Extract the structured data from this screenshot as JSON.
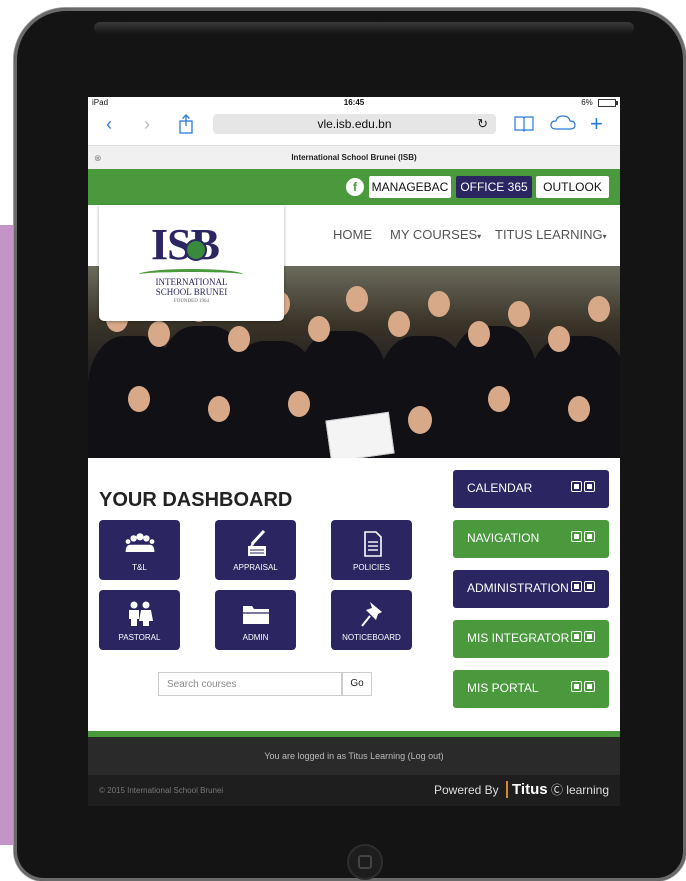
{
  "status_bar": {
    "device": "iPad",
    "time": "16:45",
    "battery": "6%"
  },
  "browser": {
    "url": "vle.isb.edu.bn",
    "tab_title": "International School Brunei (ISB)"
  },
  "top_links": {
    "facebook": "f",
    "managebac": "MANAGEBAC",
    "office365": "OFFICE 365",
    "outlook": "OUTLOOK"
  },
  "nav": {
    "home": "HOME",
    "my_courses": "MY COURSES",
    "titus_learning": "TITUS LEARNING"
  },
  "logo": {
    "mark": "ISB",
    "line1": "INTERNATIONAL",
    "line2": "SCHOOL BRUNEI",
    "line3": "FOUNDED 1964"
  },
  "dashboard": {
    "title": "YOUR DASHBOARD",
    "tiles": [
      {
        "label": "T&L",
        "icon": "group-icon"
      },
      {
        "label": "APPRAISAL",
        "icon": "pen-paper-icon"
      },
      {
        "label": "POLICIES",
        "icon": "document-icon"
      },
      {
        "label": "PASTORAL",
        "icon": "children-icon"
      },
      {
        "label": "ADMIN",
        "icon": "folder-icon"
      },
      {
        "label": "NOTICEBOARD",
        "icon": "pin-icon"
      }
    ]
  },
  "search": {
    "placeholder": "Search courses",
    "go": "Go"
  },
  "side_buttons": [
    {
      "label": "CALENDAR"
    },
    {
      "label": "NAVIGATION"
    },
    {
      "label": "ADMINISTRATION"
    },
    {
      "label": "MIS INTEGRATOR"
    },
    {
      "label": "MIS PORTAL"
    }
  ],
  "footer": {
    "login": "You are logged in as Titus Learning (Log out)",
    "copyright": "© 2015 International School Brunei",
    "powered_by": "Powered By",
    "brand": "Titus",
    "brand_suffix": "learning"
  },
  "colors": {
    "purple": "#2b2562",
    "green": "#4a9a3d"
  }
}
